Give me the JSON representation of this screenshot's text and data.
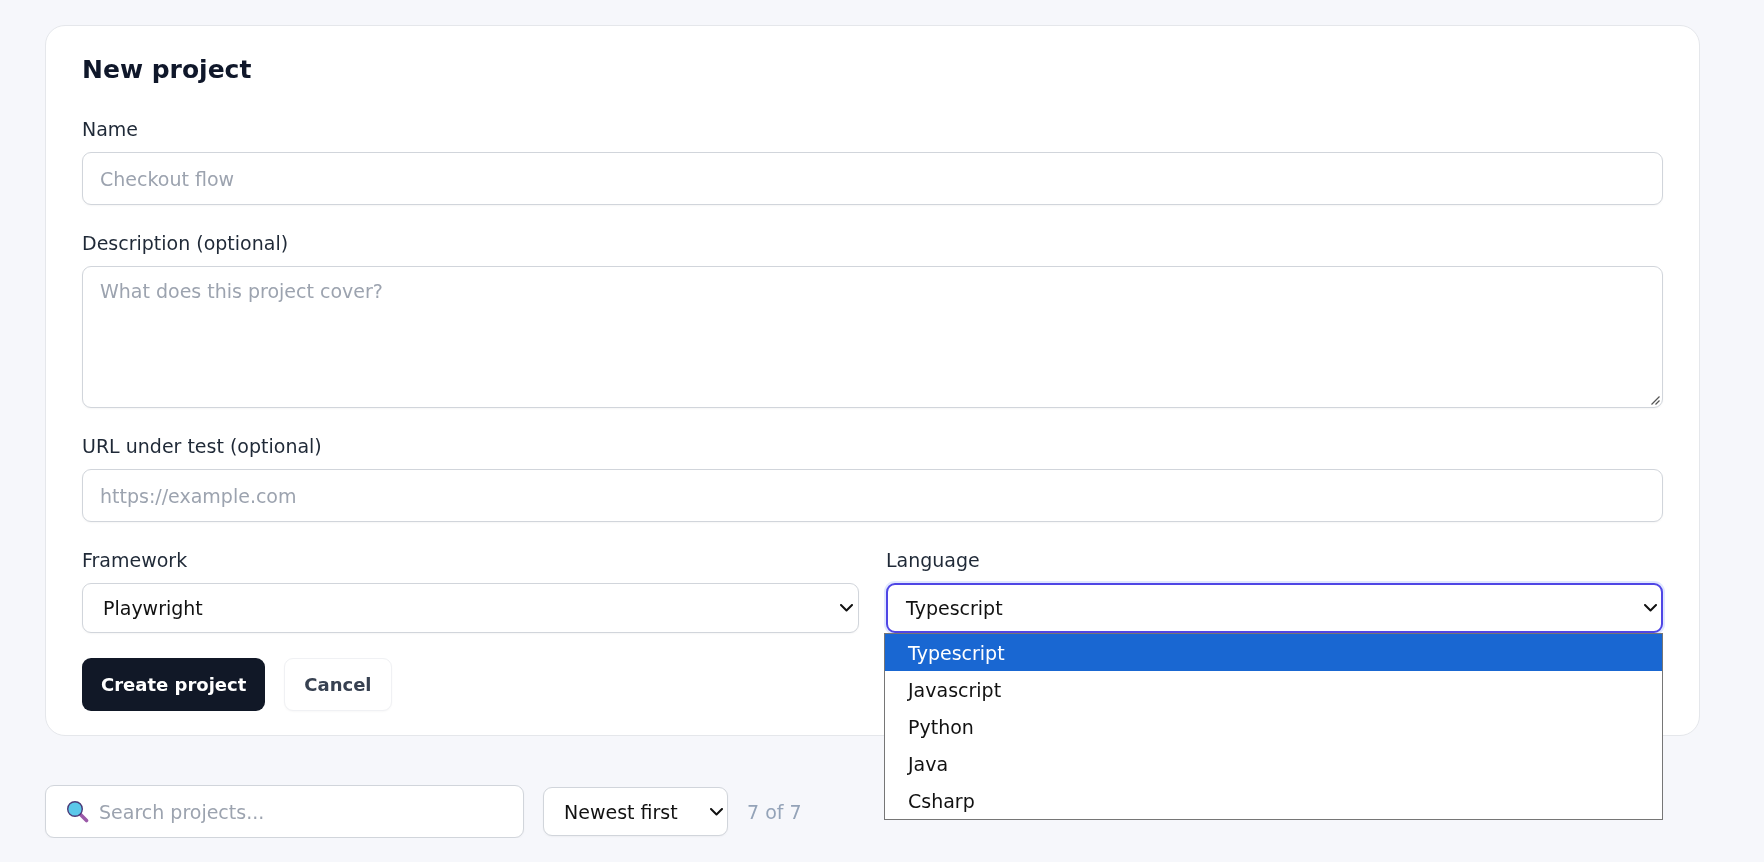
{
  "form": {
    "title": "New project",
    "fields": [
      {
        "kind": "input",
        "label": "Name",
        "placeholder": "Checkout flow"
      },
      {
        "kind": "textarea",
        "label": "Description (optional)",
        "placeholder": "What does this project cover?"
      },
      {
        "kind": "input",
        "label": "URL under test (optional)",
        "placeholder": "https://example.com"
      }
    ],
    "selects": [
      {
        "label": "Framework",
        "value": "Playwright",
        "focused": false
      },
      {
        "label": "Language",
        "value": "Typescript",
        "focused": true,
        "expanded": true,
        "options": [
          {
            "label": "Typescript",
            "selected": true
          },
          {
            "label": "Javascript",
            "selected": false
          },
          {
            "label": "Python",
            "selected": false
          },
          {
            "label": "Java",
            "selected": false
          },
          {
            "label": "Csharp",
            "selected": false
          }
        ]
      }
    ],
    "buttons": [
      {
        "kind": "primary",
        "label": "Create project"
      },
      {
        "kind": "secondary",
        "label": "Cancel"
      }
    ]
  },
  "toolbar": {
    "search": {
      "placeholder": "Search projects..."
    },
    "sort": {
      "value": "Newest first"
    },
    "count": "7 of 7"
  }
}
